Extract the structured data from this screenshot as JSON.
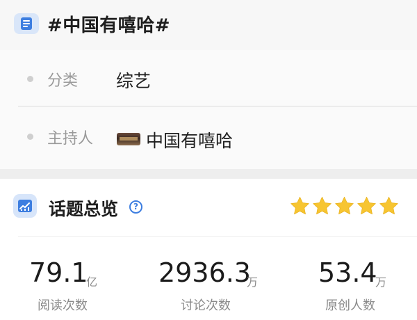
{
  "topic": {
    "title": "#中国有嘻哈#",
    "title_icon": "list-doc-icon"
  },
  "details": {
    "category_label": "分类",
    "category_value": "综艺",
    "host_label": "主持人",
    "host_value": "中国有嘻哈"
  },
  "overview": {
    "title": "话题总览",
    "icon": "bar-chart-icon",
    "help_icon": "help-icon",
    "rating_stars": 5,
    "stats": [
      {
        "value": "79.1",
        "unit": "亿",
        "label": "阅读次数"
      },
      {
        "value": "2936.3",
        "unit": "万",
        "label": "讨论次数"
      },
      {
        "value": "53.4",
        "unit": "万",
        "label": "原创人数"
      }
    ]
  },
  "colors": {
    "accent_blue": "#3d7ee0",
    "star_gold": "#f7c531",
    "muted_text": "#9a9a9a"
  }
}
